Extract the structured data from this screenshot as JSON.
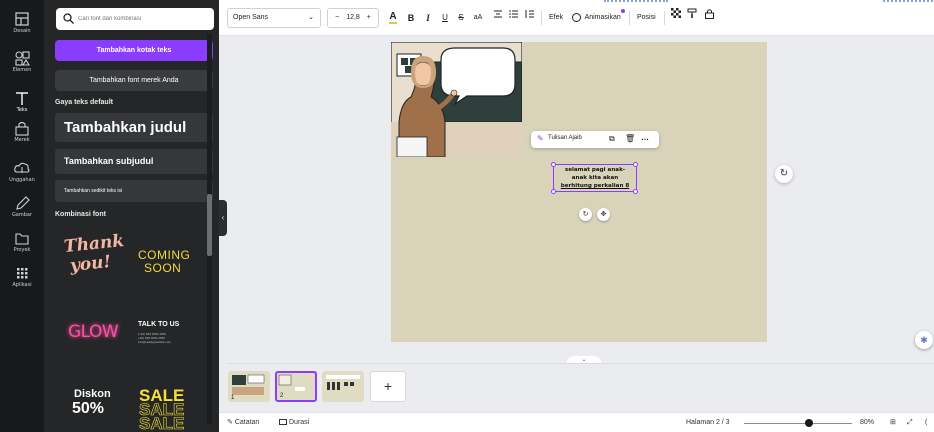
{
  "rail": {
    "items": [
      {
        "label": "Desain",
        "icon": "layout-icon"
      },
      {
        "label": "Elemen",
        "icon": "shapes-icon"
      },
      {
        "label": "Teks",
        "icon": "text-icon"
      },
      {
        "label": "Merek",
        "icon": "brand-icon"
      },
      {
        "label": "Unggahan",
        "icon": "upload-icon"
      },
      {
        "label": "Gambar",
        "icon": "draw-icon"
      },
      {
        "label": "Proyek",
        "icon": "folder-icon"
      },
      {
        "label": "Aplikasi",
        "icon": "apps-icon"
      }
    ],
    "active_index": 2
  },
  "panel": {
    "search_placeholder": "Cari font dan kombinasi",
    "add_textbox": "Tambahkan kotak teks",
    "add_brand_font": "Tambahkan font merek Anda",
    "default_styles_label": "Gaya teks default",
    "heading": "Tambahkan judul",
    "subheading": "Tambahkan subjudul",
    "body_text": "Tambahkan sedikit teks isi",
    "combos_label": "Kombinasi font",
    "combos": {
      "thank_you": [
        "Thank",
        "you!"
      ],
      "coming_soon": [
        "COMING",
        "SOON"
      ],
      "glow": "GLOW",
      "talk": "TALK TO US",
      "talk_small": [
        "(+62) 838 4684 4050",
        "+62) 838 4684 4050",
        "info@reallygreatsite.com"
      ],
      "diskon": [
        "Diskon",
        "50%"
      ],
      "sale": "SALE"
    }
  },
  "toolbar": {
    "font_name": "Open Sans",
    "font_size": "12,8",
    "minus": "−",
    "plus": "+",
    "bold": "B",
    "italic": "I",
    "underline": "U",
    "strike": "S",
    "case": "aA",
    "effects": "Efek",
    "animate": "Animasikan",
    "position": "Posisi"
  },
  "canvas": {
    "float_bar_label": "Tulisan Ajaib",
    "textbox_lines": [
      "selamat pagi anak-",
      "anak kita akan",
      "berhitung perkalian 8"
    ]
  },
  "pages": {
    "thumbs": [
      {
        "num": "1"
      },
      {
        "num": "2"
      },
      {
        "num": ""
      }
    ],
    "active_index": 1,
    "add": "+"
  },
  "footer": {
    "notes": "Catatan",
    "duration": "Durasi",
    "page_indicator": "Halaman 2 / 3",
    "zoom": "80%",
    "zoom_fraction": 0.6
  }
}
